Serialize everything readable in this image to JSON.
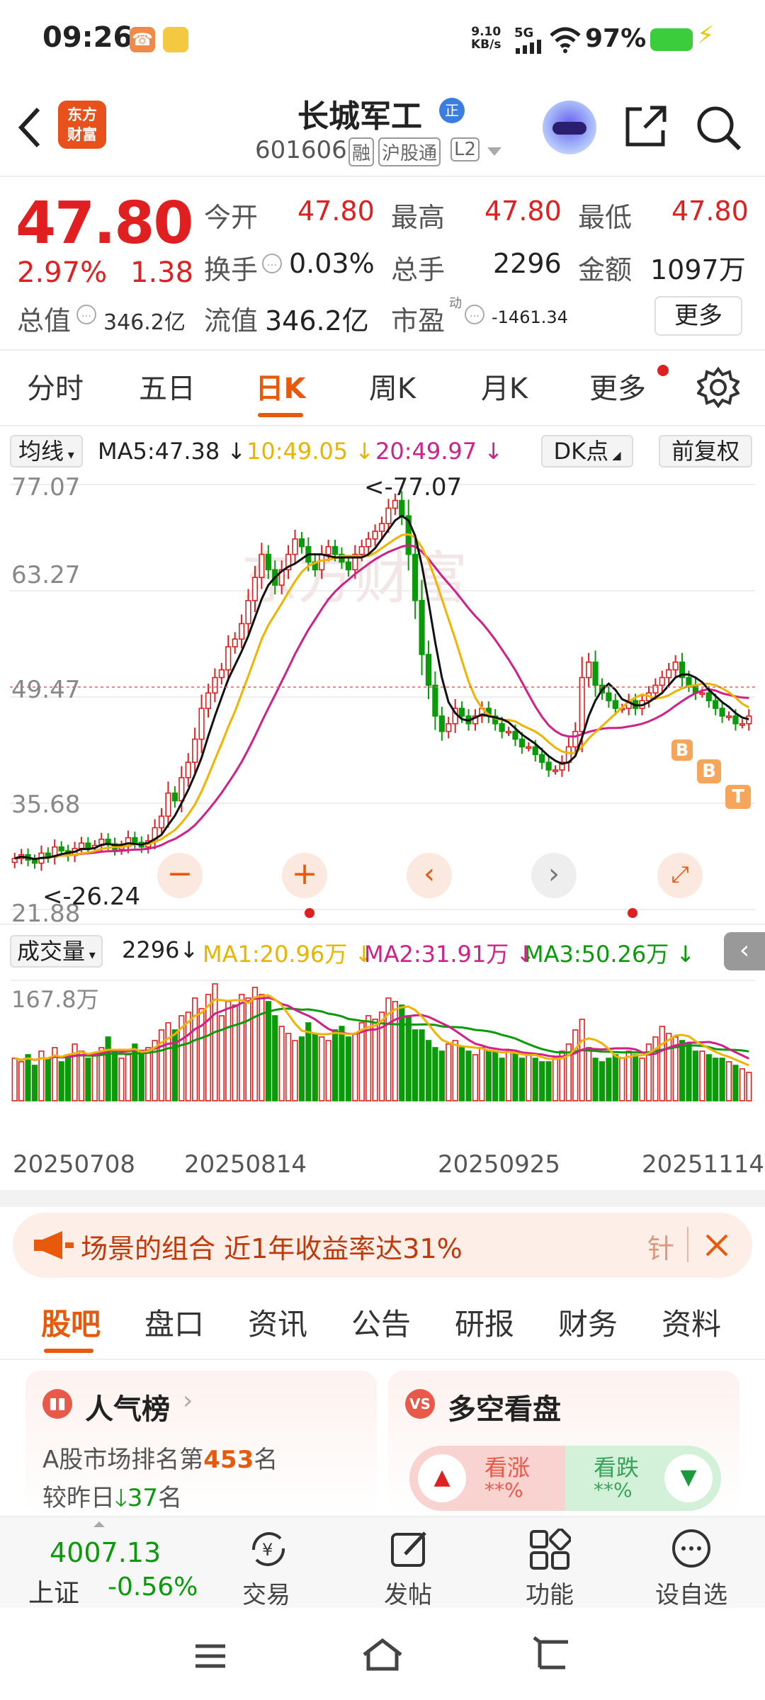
{
  "status": {
    "time": "09:26",
    "netspeed_top": "9.10",
    "netspeed_bottom": "KB/s",
    "net": "5G",
    "battery": "97%"
  },
  "header": {
    "logo_top": "东方",
    "logo_bottom": "财富",
    "title": "长城军工",
    "title_badge": "正",
    "code": "601606",
    "tag1": "融",
    "tag2": "沪股通",
    "tag3": "L2"
  },
  "quote": {
    "price": "47.80",
    "pct": "2.97%",
    "change": "1.38",
    "open_label": "今开",
    "open": "47.80",
    "high_label": "最高",
    "high": "47.80",
    "low_label": "最低",
    "low": "47.80",
    "turnover_label": "换手",
    "turnover": "0.03%",
    "vol_label": "总手",
    "vol": "2296",
    "amount_label": "金额",
    "amount": "1097万",
    "mktcap_label": "总值",
    "mktcap": "346.2亿",
    "float_label": "流值",
    "float": "346.2亿",
    "pe_label": "市盈",
    "pe_sup": "动",
    "pe": "-1461.34",
    "more": "更多"
  },
  "period_tabs": [
    "分时",
    "五日",
    "日K",
    "周K",
    "月K",
    "更多"
  ],
  "ma_bar": {
    "type": "均线",
    "ma5": "MA5:47.38 ↓",
    "ma10": "10:49.05 ↓",
    "ma20": "20:49.97 ↓",
    "dk": "DK点",
    "adj": "前复权"
  },
  "price_axis": [
    "77.07",
    "63.27",
    "49.47",
    "35.68",
    "21.88"
  ],
  "high_marker": "<-77.07",
  "low_marker": "<-26.24",
  "vol_bar": {
    "label": "成交量",
    "vol": "2296↓",
    "ma1": "MA1:20.96万 ↓",
    "ma2": "MA2:31.91万 ↓",
    "ma3": "MA3:50.26万 ↓",
    "max": "167.8万"
  },
  "dates": [
    "20250708",
    "20250814",
    "20250925",
    "20251114"
  ],
  "markers": [
    "B",
    "B",
    "T"
  ],
  "banner": {
    "text": "场景的组合 近1年收益率达31%",
    "tail": "针"
  },
  "section_tabs": [
    "股吧",
    "盘口",
    "资讯",
    "公告",
    "研报",
    "财务",
    "资料"
  ],
  "card_rank": {
    "title": "人气榜",
    "line1_pre": "A股市场排名第",
    "rank": "453",
    "line1_post": "名",
    "line2_pre": "较昨日",
    "delta": "37",
    "line2_post": "名"
  },
  "card_vs": {
    "title": "多空看盘",
    "up": "看涨",
    "down": "看跌",
    "up_val": "**%",
    "down_val": "**%"
  },
  "bottom_nav": {
    "index_val": "4007.13",
    "index_name": "上证",
    "index_pct": "-0.56%",
    "trade": "交易",
    "post": "发帖",
    "func": "功能",
    "watch": "设自选"
  },
  "colors": {
    "up": "#e02020",
    "down": "#0a9a0a",
    "accent": "#e8590c",
    "ma5": "#111111",
    "ma10": "#f0b400",
    "ma20": "#d0208a"
  },
  "chart_data": {
    "type": "candlestick",
    "y_range": [
      21.88,
      77.07
    ],
    "ma_values": {
      "MA5": 47.38,
      "MA10": 49.05,
      "MA20": 49.97
    },
    "high": 77.07,
    "low": 26.24,
    "close": [
      28.5,
      29,
      28.3,
      27.9,
      29.2,
      28.7,
      30,
      29.5,
      28.9,
      29.8,
      30.5,
      29.9,
      30.2,
      31,
      30.4,
      29.7,
      30.1,
      31.2,
      30.6,
      30,
      30.8,
      32.5,
      34,
      37,
      36,
      39,
      41,
      44,
      48,
      50,
      52,
      53,
      56,
      57,
      59,
      62,
      65,
      68,
      66,
      64,
      66,
      68,
      70,
      69,
      67,
      66,
      68,
      69,
      68,
      67,
      66,
      68,
      69,
      70,
      71,
      72,
      74,
      75,
      73,
      68,
      62,
      55,
      51,
      47,
      45,
      46,
      48,
      47,
      46,
      47,
      48,
      47,
      46,
      45,
      45,
      44,
      43,
      43,
      42,
      41,
      40,
      40,
      41,
      43,
      45,
      52,
      54,
      51,
      50,
      49,
      48,
      48,
      49,
      48,
      49,
      50,
      51,
      52,
      53,
      54,
      52,
      51,
      50,
      50,
      49,
      48,
      47,
      47,
      46,
      46,
      47
    ],
    "volume": [
      60,
      55,
      65,
      50,
      70,
      60,
      75,
      55,
      65,
      80,
      70,
      60,
      65,
      75,
      90,
      70,
      60,
      65,
      80,
      70,
      75,
      85,
      100,
      110,
      100,
      120,
      125,
      145,
      130,
      150,
      165,
      120,
      140,
      135,
      150,
      145,
      160,
      150,
      140,
      120,
      105,
      95,
      85,
      90,
      110,
      95,
      90,
      85,
      100,
      105,
      90,
      95,
      110,
      120,
      115,
      125,
      145,
      140,
      135,
      120,
      100,
      100,
      85,
      75,
      70,
      80,
      85,
      75,
      70,
      65,
      75,
      70,
      70,
      60,
      70,
      68,
      60,
      65,
      60,
      55,
      55,
      60,
      70,
      80,
      100,
      115,
      75,
      60,
      55,
      60,
      65,
      60,
      70,
      65,
      60,
      80,
      90,
      105,
      95,
      90,
      85,
      80,
      70,
      70,
      65,
      60,
      60,
      55,
      50,
      45,
      40
    ]
  }
}
